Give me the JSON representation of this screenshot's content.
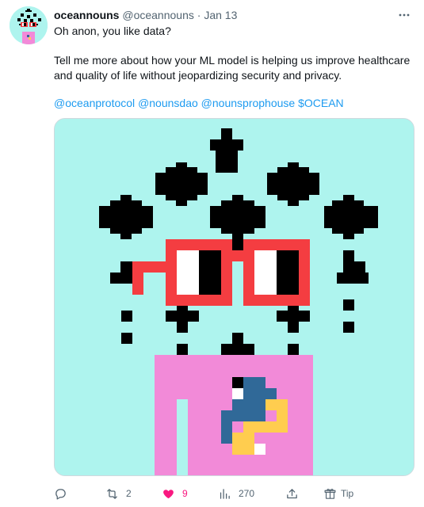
{
  "tweet": {
    "author_name": "oceannouns",
    "author_handle": "@oceannouns",
    "separator": "·",
    "date": "Jan 13",
    "text_line1": "Oh anon, you like data?",
    "text_line2": "Tell me more about how your ML model is helping us improve healthcare",
    "text_line3": "and quality of life without jeopardizing security and privacy.",
    "mentions": [
      "@oceanprotocol",
      "@nounsdao",
      "@nounsprophouse",
      "$OCEAN"
    ]
  },
  "actions": {
    "reply_icon": "reply-icon",
    "retweet_icon": "retweet-icon",
    "retweet_count": "2",
    "like_icon": "heart-filled-icon",
    "like_count": "9",
    "views_icon": "analytics-icon",
    "views_count": "270",
    "share_icon": "share-icon",
    "tip_icon": "tip-icon",
    "tip_label": "Tip"
  },
  "colors": {
    "link": "#1d9bf0",
    "secondary_text": "#536471",
    "like": "#f91880",
    "noun_background": "#aef4ee",
    "noun_glasses": "#f43d41",
    "noun_body": "#f28ad8",
    "python_blue": "#306998",
    "python_yellow": "#ffcd4f"
  }
}
